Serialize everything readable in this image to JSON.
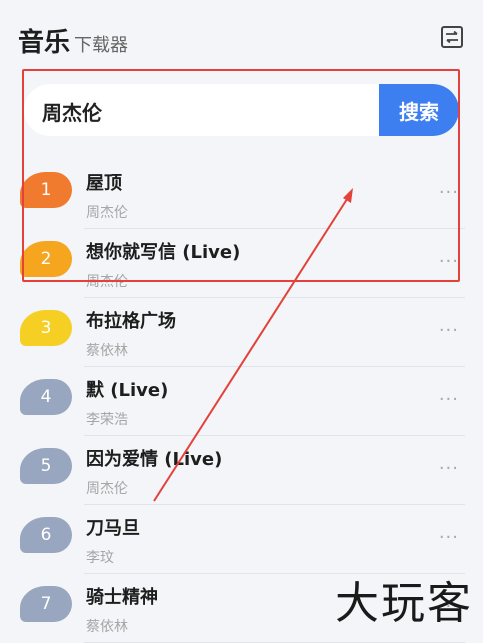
{
  "header": {
    "title_main": "音乐",
    "title_sub": "下载器",
    "icon": "swap-icon"
  },
  "search": {
    "value": "周杰伦",
    "button_label": "搜索"
  },
  "songs": [
    {
      "rank": "1",
      "title": "屋顶",
      "artist": "周杰伦",
      "color": "#f07a2e"
    },
    {
      "rank": "2",
      "title": "想你就写信 (Live)",
      "artist": "周杰伦",
      "color": "#f5a51e"
    },
    {
      "rank": "3",
      "title": "布拉格广场",
      "artist": "蔡依林",
      "color": "#f6cf24"
    },
    {
      "rank": "4",
      "title": "默 (Live)",
      "artist": "李荣浩",
      "color": "#98a7bf"
    },
    {
      "rank": "5",
      "title": "因为爱情 (Live)",
      "artist": "周杰伦",
      "color": "#98a7bf"
    },
    {
      "rank": "6",
      "title": "刀马旦",
      "artist": "李玟",
      "color": "#98a7bf"
    },
    {
      "rank": "7",
      "title": "骑士精神",
      "artist": "蔡依林",
      "color": "#98a7bf"
    }
  ],
  "more_label": "···",
  "watermark": "大玩客",
  "colors": {
    "accent": "#3d7ef0",
    "annotation": "#e4413a"
  }
}
